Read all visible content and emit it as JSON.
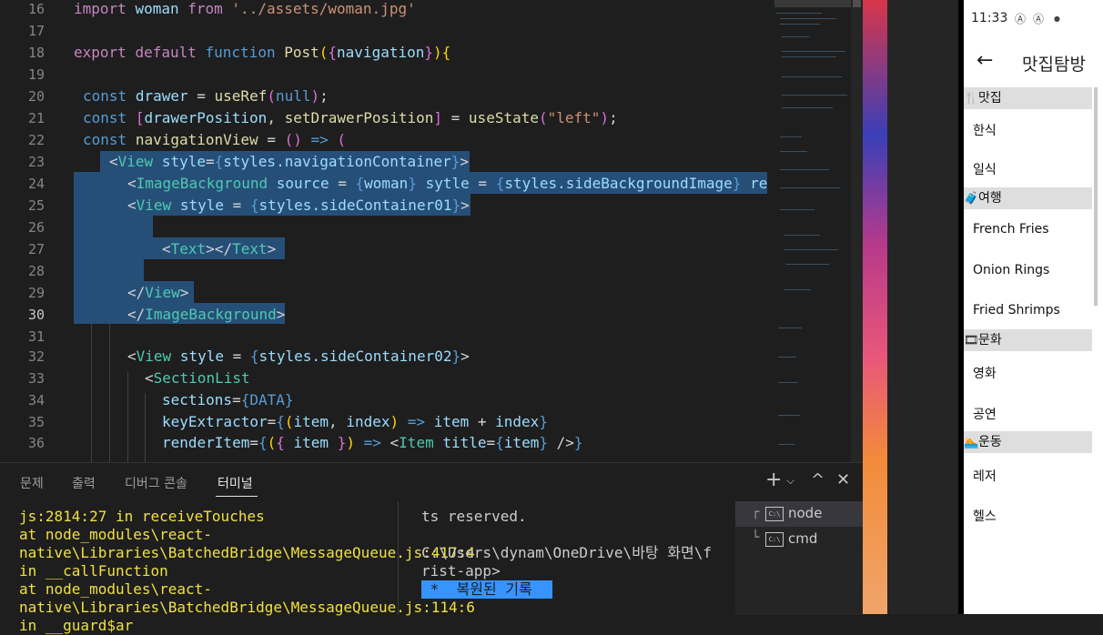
{
  "editor": {
    "lines": [
      {
        "n": "16"
      },
      {
        "n": "17"
      },
      {
        "n": "18"
      },
      {
        "n": "19"
      },
      {
        "n": "20"
      },
      {
        "n": "21"
      },
      {
        "n": "22"
      },
      {
        "n": "23"
      },
      {
        "n": "24"
      },
      {
        "n": "25"
      },
      {
        "n": "26"
      },
      {
        "n": "27"
      },
      {
        "n": "28"
      },
      {
        "n": "29"
      },
      {
        "n": "30"
      },
      {
        "n": "31"
      },
      {
        "n": "32"
      },
      {
        "n": "33"
      },
      {
        "n": "34"
      },
      {
        "n": "35"
      },
      {
        "n": "36"
      }
    ],
    "active_line": "30"
  },
  "panel": {
    "tabs": [
      "문제",
      "출력",
      "디버그 콘솔",
      "터미널"
    ],
    "active_tab": "터미널",
    "add_icon": "plus-icon",
    "terminal_left": "js:2814:27 in receiveTouches\nat node_modules\\react-native\\Libraries\\BatchedBridge\\MessageQueue.js:417:4 in __callFunction\nat node_modules\\react-native\\Libraries\\BatchedBridge\\MessageQueue.js:114:6 in __guard$ar",
    "terminal_right": "ts reserved.\n\nC:\\Users\\dynam\\OneDrive\\바탕 화면\\f\nrist-app>",
    "restored_label": "복원된 기록",
    "terminals": [
      {
        "name": "node",
        "active": true
      },
      {
        "name": "cmd",
        "active": false
      }
    ]
  },
  "phone": {
    "status_time": "11:33",
    "title": "맛집탐방",
    "sections": [
      {
        "title": "맛집",
        "icon": "fork-knife-icon",
        "items": [
          "한식",
          "일식"
        ]
      },
      {
        "title": "여행",
        "icon": "suitcase-icon",
        "items": [
          "French Fries",
          "Onion Rings",
          "Fried Shrimps"
        ]
      },
      {
        "title": "문화",
        "icon": "film-icon",
        "items": [
          "영화",
          "공연"
        ]
      },
      {
        "title": "운동",
        "icon": "swimmer-icon",
        "items": [
          "레저",
          "헬스"
        ]
      }
    ]
  }
}
